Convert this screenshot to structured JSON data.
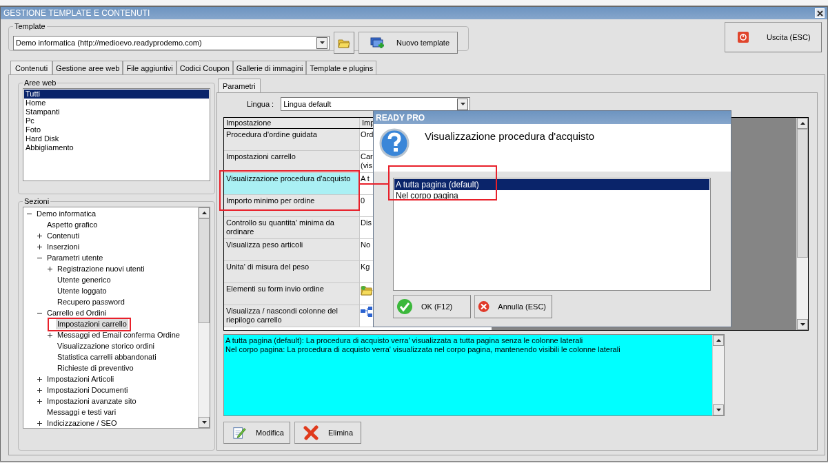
{
  "window": {
    "title": "GESTIONE TEMPLATE E CONTENUTI"
  },
  "template": {
    "label": "Template",
    "value": "Demo informatica (http://medioevo.readyprodemo.com)",
    "new_button": "Nuovo template"
  },
  "exit_button": "Uscita (ESC)",
  "tabs": [
    {
      "label": "Contenuti",
      "selected": true
    },
    {
      "label": "Gestione aree web",
      "selected": false
    },
    {
      "label": "File aggiuntivi",
      "selected": false
    },
    {
      "label": "Codici Coupon",
      "selected": false
    },
    {
      "label": "Gallerie di immagini",
      "selected": false
    },
    {
      "label": "Template e plugins",
      "selected": false
    }
  ],
  "web_areas": {
    "label": "Aree web",
    "items": [
      {
        "label": "Tutti",
        "selected": true
      },
      {
        "label": "Home",
        "selected": false
      },
      {
        "label": "Stampanti",
        "selected": false
      },
      {
        "label": "Pc",
        "selected": false
      },
      {
        "label": "Foto",
        "selected": false
      },
      {
        "label": "Hard Disk",
        "selected": false
      },
      {
        "label": "Abbigliamento",
        "selected": false
      }
    ]
  },
  "sections": {
    "label": "Sezioni",
    "tree": [
      {
        "label": "Demo informatica",
        "expanded": true,
        "selected": false,
        "children": [
          {
            "label": "Aspetto grafico",
            "selected": false
          },
          {
            "label": "Contenuti",
            "expanded": false,
            "selected": false
          },
          {
            "label": "Inserzioni",
            "expanded": false,
            "selected": false
          },
          {
            "label": "Parametri utente",
            "expanded": true,
            "selected": false,
            "children": [
              {
                "label": "Registrazione nuovi utenti",
                "expanded": false,
                "selected": false
              },
              {
                "label": "Utente generico",
                "selected": false
              },
              {
                "label": "Utente loggato",
                "selected": false
              },
              {
                "label": "Recupero password",
                "selected": false
              }
            ]
          },
          {
            "label": "Carrello ed Ordini",
            "expanded": true,
            "selected": false,
            "children": [
              {
                "label": "Impostazioni carrello",
                "selected": true
              },
              {
                "label": "Messaggi ed Email conferma Ordine",
                "expanded": false,
                "selected": false
              },
              {
                "label": "Visualizzazione storico ordini",
                "selected": false
              },
              {
                "label": "Statistica carrelli abbandonati",
                "selected": false
              },
              {
                "label": "Richieste di preventivo",
                "selected": false
              }
            ]
          },
          {
            "label": "Impostazioni Articoli",
            "expanded": false,
            "selected": false
          },
          {
            "label": "Impostazioni Documenti",
            "expanded": false,
            "selected": false
          },
          {
            "label": "Impostazioni avanzate sito",
            "expanded": false,
            "selected": false
          },
          {
            "label": "Messaggi e testi vari",
            "selected": false
          },
          {
            "label": "Indicizzazione / SEO",
            "expanded": false,
            "selected": false
          }
        ]
      }
    ]
  },
  "params": {
    "tab": "Parametri",
    "language_label": "Lingua :",
    "language": "Lingua default",
    "columns": [
      "Impostazione",
      "Imp"
    ],
    "rows": [
      {
        "setting": "Procedura d'ordine guidata",
        "kind": "text",
        "value": "Ord",
        "selected": false
      },
      {
        "setting": "Impostazioni carrello",
        "kind": "text",
        "value": "Car\n(vis",
        "selected": false
      },
      {
        "setting": "Visualizzazione procedura d'acquisto",
        "kind": "text",
        "value": "A t",
        "selected": true
      },
      {
        "setting": "Importo minimo per ordine",
        "kind": "text",
        "value": "0",
        "selected": false
      },
      {
        "setting": "Controllo su quantita' minima da ordinare",
        "kind": "text",
        "value": "Dis",
        "selected": false
      },
      {
        "setting": "Visualizza peso articoli",
        "kind": "text",
        "value": "No",
        "selected": false
      },
      {
        "setting": "Unita' di misura del peso",
        "kind": "text",
        "value": "Kg",
        "selected": false
      },
      {
        "setting": "Elementi su form invio ordine",
        "kind": "folder",
        "selected": false
      },
      {
        "setting": "Visualizza / nascondi colonne del riepilogo carrello",
        "kind": "columns",
        "selected": false
      }
    ]
  },
  "description": [
    "A tutta pagina (default): La procedura di acquisto verra' visualizzata a tutta pagina senza le colonne laterali",
    "Nel corpo pagina: La procedura di acquisto verra' visualizzata nel corpo pagina, mantenendo visibili le colonne laterali"
  ],
  "buttons": [
    {
      "label": "Modifica",
      "kind": "edit"
    },
    {
      "label": "Elimina",
      "kind": "delete"
    }
  ],
  "dialog": {
    "title": "READY PRO",
    "heading": "Visualizzazione procedura d'acquisto",
    "options": [
      {
        "label": "A tutta pagina (default)",
        "selected": true
      },
      {
        "label": "Nel corpo pagina",
        "selected": false
      }
    ],
    "buttons": [
      {
        "label": "OK (F12)",
        "kind": "ok"
      },
      {
        "label": "Annulla (ESC)",
        "kind": "cancel"
      }
    ]
  }
}
